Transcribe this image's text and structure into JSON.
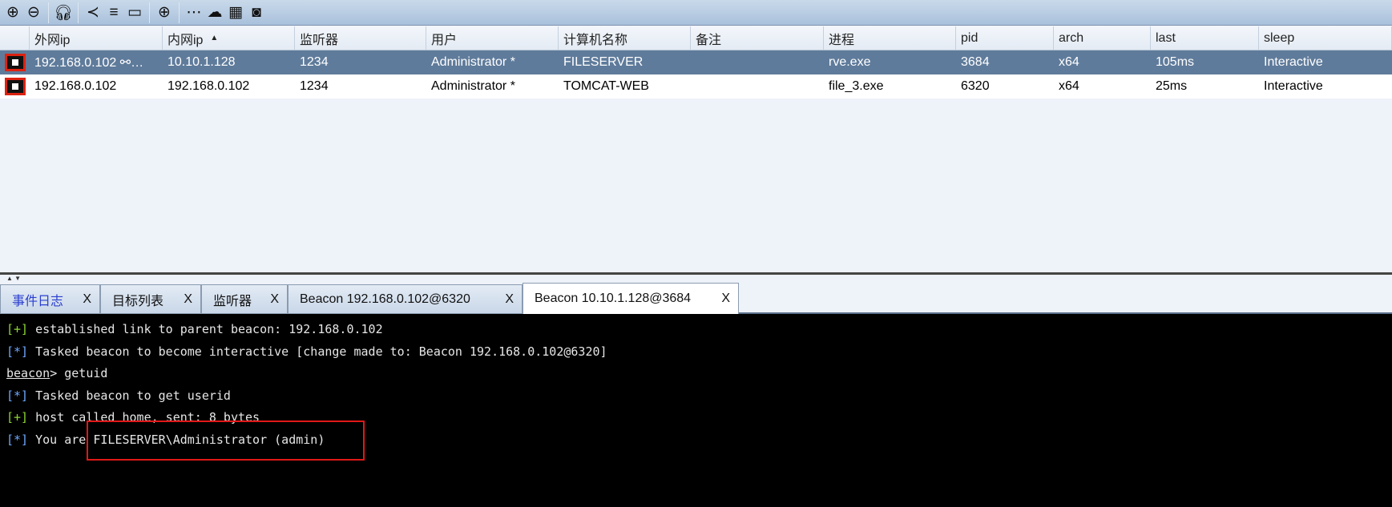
{
  "toolbar": {
    "icons": [
      "plus-circle-icon",
      "minus-circle-icon",
      "headphones-icon",
      "share-icon",
      "list-icon",
      "laptop-icon",
      "globe-icon",
      "dots-icon",
      "cloud-download-icon",
      "keyboard-icon",
      "camera-icon"
    ]
  },
  "table": {
    "columns": [
      "外网ip",
      "内网ip",
      "监听器",
      "用户",
      "计算机名称",
      "备注",
      "进程",
      "pid",
      "arch",
      "last",
      "sleep"
    ],
    "sort_indicator": "▲",
    "rows": [
      {
        "external": "192.168.0.102 ⚯…",
        "internal": "10.10.1.128",
        "listener": "1234",
        "user": "Administrator *",
        "computer": "FILESERVER",
        "note": "",
        "process": "rve.exe",
        "pid": "3684",
        "arch": "x64",
        "last": "105ms",
        "sleep": "Interactive"
      },
      {
        "external": "192.168.0.102",
        "internal": "192.168.0.102",
        "listener": "1234",
        "user": "Administrator *",
        "computer": "TOMCAT-WEB",
        "note": "",
        "process": "file_3.exe",
        "pid": "6320",
        "arch": "x64",
        "last": "25ms",
        "sleep": "Interactive"
      }
    ]
  },
  "tabs": [
    {
      "label": "事件日志",
      "close": "X"
    },
    {
      "label": "目标列表",
      "close": "X"
    },
    {
      "label": "监听器",
      "close": "X"
    },
    {
      "label": "Beacon 192.168.0.102@6320",
      "close": "X"
    },
    {
      "label": "Beacon 10.10.1.128@3684",
      "close": "X"
    }
  ],
  "console": {
    "lines": [
      {
        "tag": "[+]",
        "text": " established link to parent beacon: 192.168.0.102"
      },
      {
        "tag": "[*]",
        "text": " Tasked beacon to become interactive [change made to: Beacon 192.168.0.102@6320]"
      },
      {
        "prompt": "beacon",
        "text": "> getuid"
      },
      {
        "tag": "[*]",
        "text": " Tasked beacon to get userid"
      },
      {
        "tag": "[+]",
        "text": " host called home, sent: 8 bytes"
      },
      {
        "tag": "[*]",
        "text": " You are FILESERVER\\Administrator (admin)"
      }
    ]
  }
}
